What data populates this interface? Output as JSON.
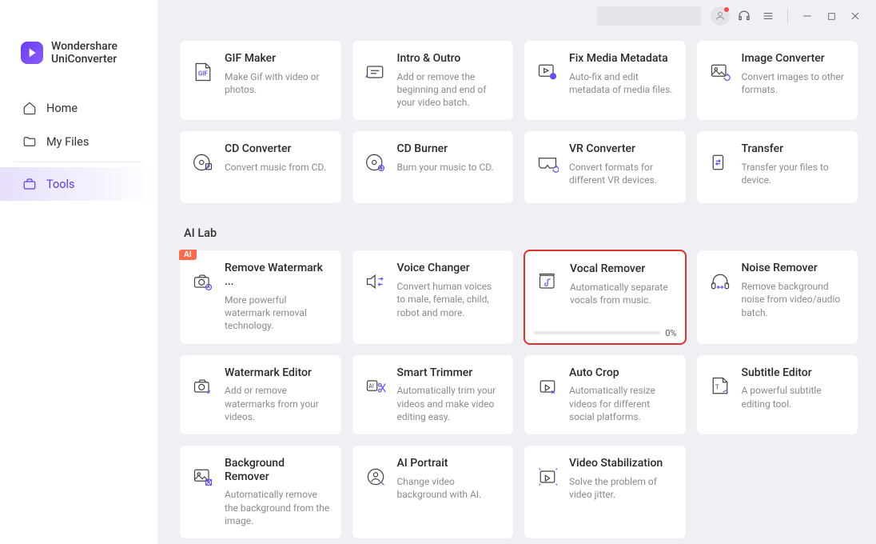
{
  "brand": {
    "line1": "Wondershare",
    "line2": "UniConverter"
  },
  "nav": {
    "home": "Home",
    "myfiles": "My Files",
    "tools": "Tools"
  },
  "section_ailab": "AI Lab",
  "vocal_progress": "0%",
  "cards": {
    "gif": {
      "title": "GIF Maker",
      "desc": "Make Gif with video or photos."
    },
    "intro": {
      "title": "Intro & Outro",
      "desc": "Add or remove the beginning and end of your video batch."
    },
    "metadata": {
      "title": "Fix Media Metadata",
      "desc": "Auto-fix and edit metadata of media files."
    },
    "imgconv": {
      "title": "Image Converter",
      "desc": "Convert images to other formats."
    },
    "cdconv": {
      "title": "CD Converter",
      "desc": "Convert music from CD."
    },
    "cdburn": {
      "title": "CD Burner",
      "desc": "Burn your music to CD."
    },
    "vr": {
      "title": "VR Converter",
      "desc": "Convert formats for different VR devices."
    },
    "transfer": {
      "title": "Transfer",
      "desc": "Transfer your files to device."
    },
    "watermark": {
      "title": "Remove Watermark ...",
      "desc": "More powerful watermark removal technology."
    },
    "voice": {
      "title": "Voice Changer",
      "desc": "Convert human voices to male, female, child, robot and more."
    },
    "vocal": {
      "title": "Vocal Remover",
      "desc": "Automatically separate vocals from music."
    },
    "noise": {
      "title": "Noise Remover",
      "desc": "Remove background noise from video/audio batch."
    },
    "wmedit": {
      "title": "Watermark Editor",
      "desc": "Add or remove watermarks from your videos."
    },
    "trim": {
      "title": "Smart Trimmer",
      "desc": "Automatically trim your videos and make video editing easy."
    },
    "crop": {
      "title": "Auto Crop",
      "desc": "Automatically resize videos for different social platforms."
    },
    "subtitle": {
      "title": "Subtitle Editor",
      "desc": "A powerful subtitle editing tool."
    },
    "bgremove": {
      "title": "Background Remover",
      "desc": "Automatically remove the background from the image."
    },
    "portrait": {
      "title": "AI Portrait",
      "desc": "Change video background with AI."
    },
    "stab": {
      "title": "Video Stabilization",
      "desc": "Solve the problem of video jitter."
    }
  },
  "ai_badge": "AI"
}
